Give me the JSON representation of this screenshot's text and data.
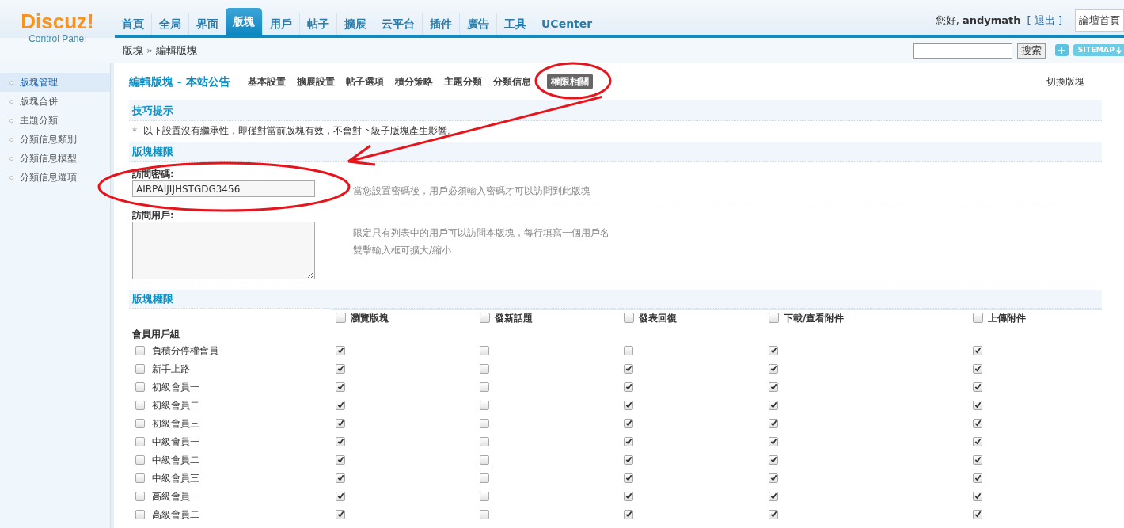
{
  "logo": {
    "title": "Discuz!",
    "subtitle": "Control Panel"
  },
  "nav": [
    {
      "label": "首頁",
      "selected": false
    },
    {
      "label": "全局",
      "selected": false
    },
    {
      "label": "界面",
      "selected": false
    },
    {
      "label": "版塊",
      "selected": true
    },
    {
      "label": "用戶",
      "selected": false
    },
    {
      "label": "帖子",
      "selected": false
    },
    {
      "label": "擴展",
      "selected": false
    },
    {
      "label": "云平台",
      "selected": false
    },
    {
      "label": "插件",
      "selected": false
    },
    {
      "label": "廣告",
      "selected": false
    },
    {
      "label": "工具",
      "selected": false
    },
    {
      "label": "UCenter",
      "selected": false
    }
  ],
  "user": {
    "greeting": "您好,",
    "name": "andymath",
    "logout": "[ 退出 ]",
    "home": "論壇首頁"
  },
  "breadcrumb": [
    "版塊",
    "»",
    "編輯版塊"
  ],
  "search": {
    "button": "搜索",
    "plus": "+",
    "sitemap": "SITEMAP"
  },
  "sidebar": [
    {
      "label": "版塊管理",
      "selected": true
    },
    {
      "label": "版塊合併",
      "selected": false
    },
    {
      "label": "主題分類",
      "selected": false
    },
    {
      "label": "分類信息類別",
      "selected": false
    },
    {
      "label": "分類信息模型",
      "selected": false
    },
    {
      "label": "分類信息選項",
      "selected": false
    }
  ],
  "page_title": "編輯版塊 - 本站公告",
  "tabs": [
    {
      "label": "基本設置",
      "selected": false
    },
    {
      "label": "擴展設置",
      "selected": false
    },
    {
      "label": "帖子選項",
      "selected": false
    },
    {
      "label": "積分策略",
      "selected": false
    },
    {
      "label": "主題分類",
      "selected": false
    },
    {
      "label": "分類信息",
      "selected": false
    },
    {
      "label": "權限相關",
      "selected": true
    }
  ],
  "switch_forum": "切換版塊",
  "tips": {
    "title": "技巧提示",
    "bullet": "*",
    "text": "以下設置沒有繼承性，即僅對當前版塊有效，不會對下級子版塊產生影響。"
  },
  "access": {
    "title": "版塊權限",
    "fields": [
      {
        "label": "訪問密碼:",
        "kind": "input",
        "value": "AIRPAIJIJHSTGDG3456",
        "hints": [
          "當您設置密碼後，用戶必須輸入密碼才可以訪問到此版塊"
        ]
      },
      {
        "label": "訪問用戶:",
        "kind": "textarea",
        "hints": [
          "限定只有列表中的用戶可以訪問本版塊，每行填寫一個用戶名",
          "雙擊輸入框可擴大/縮小"
        ]
      }
    ]
  },
  "permissions": {
    "title": "版塊權限",
    "columns": [
      {
        "label": "瀏覽版塊",
        "checked": false
      },
      {
        "label": "發新話題",
        "checked": false
      },
      {
        "label": "發表回復",
        "checked": false
      },
      {
        "label": "下載/查看附件",
        "checked": false
      },
      {
        "label": "上傳附件",
        "checked": false
      }
    ],
    "group_title": "會員用戶組",
    "rows": [
      {
        "name": "負積分停權會員",
        "checked": false,
        "perms": [
          true,
          false,
          false,
          true,
          true
        ]
      },
      {
        "name": "新手上路",
        "checked": false,
        "perms": [
          true,
          false,
          true,
          true,
          true
        ]
      },
      {
        "name": "初級會員一",
        "checked": false,
        "perms": [
          true,
          false,
          true,
          true,
          true
        ]
      },
      {
        "name": "初級會員二",
        "checked": false,
        "perms": [
          true,
          false,
          true,
          true,
          true
        ]
      },
      {
        "name": "初級會員三",
        "checked": false,
        "perms": [
          true,
          false,
          true,
          true,
          true
        ]
      },
      {
        "name": "中級會員一",
        "checked": false,
        "perms": [
          true,
          false,
          true,
          true,
          true
        ]
      },
      {
        "name": "中級會員二",
        "checked": false,
        "perms": [
          true,
          false,
          true,
          true,
          true
        ]
      },
      {
        "name": "中級會員三",
        "checked": false,
        "perms": [
          true,
          false,
          true,
          true,
          true
        ]
      },
      {
        "name": "高級會員一",
        "checked": false,
        "perms": [
          true,
          false,
          true,
          true,
          true
        ]
      },
      {
        "name": "高級會員二",
        "checked": false,
        "perms": [
          true,
          false,
          true,
          true,
          true
        ]
      }
    ]
  }
}
